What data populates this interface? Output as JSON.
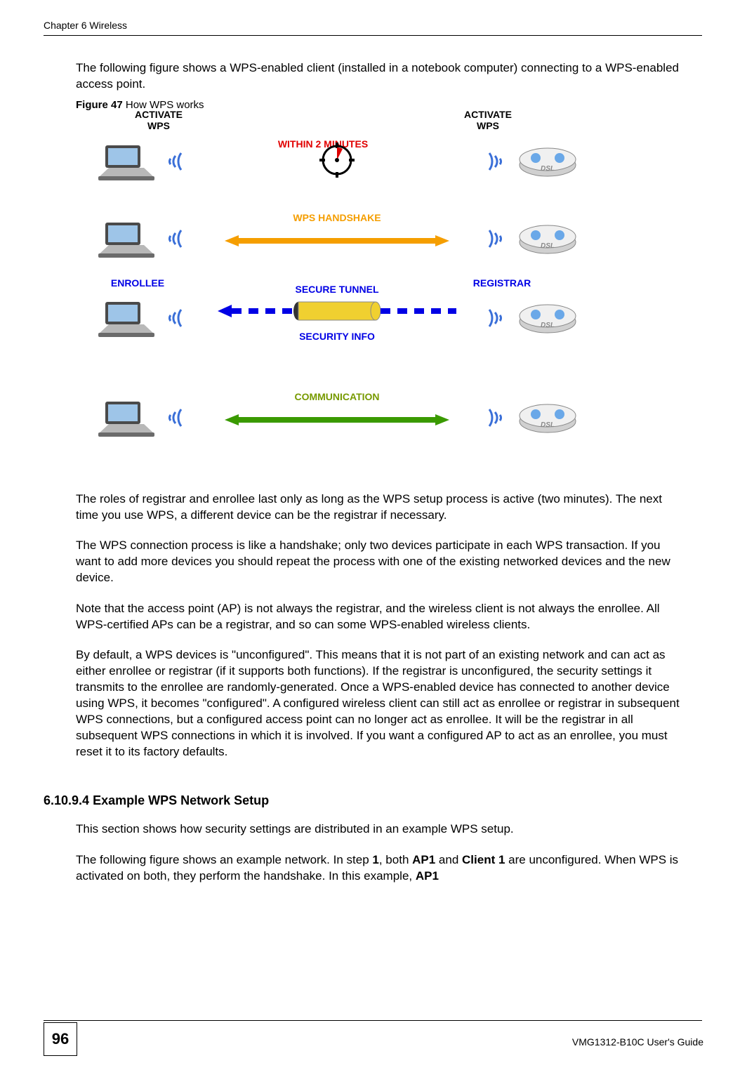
{
  "header": {
    "left": "Chapter 6 Wireless"
  },
  "paragraphs": {
    "p1": "The following figure shows a WPS-enabled client (installed in a notebook computer) connecting to a WPS-enabled access point.",
    "figcap_b": "Figure 47",
    "figcap_r": "   How WPS works",
    "p2": "The roles of registrar and enrollee last only as long as the WPS setup process is active (two minutes). The next time you use WPS, a different device can be the registrar if necessary.",
    "p3": "The WPS connection process is like a handshake; only two devices participate in each WPS transaction. If you want to add more devices you should repeat the process with one of the existing networked devices and the new device.",
    "p4": "Note that the access point (AP) is not always the registrar, and the wireless client is not always the enrollee. All WPS-certified APs can be a registrar, and so can some WPS-enabled wireless clients.",
    "p5": "By default, a WPS devices is \"unconfigured\". This means that it is not part of an existing network and can act as either enrollee or registrar (if it supports both functions). If the registrar is unconfigured, the security settings it transmits to the enrollee are randomly-generated. Once a WPS-enabled device has connected to another device using WPS, it becomes \"configured\". A configured wireless client can still act as enrollee or registrar in subsequent WPS connections, but a configured access point can no longer act as enrollee. It will be the registrar in all subsequent WPS connections in which it is involved. If you want a configured AP to act as an enrollee, you must reset it to its factory defaults.",
    "secnum": "6.10.9.4",
    "sectitle": "  Example WPS Network Setup",
    "p6": "This section shows how security settings are distributed in an example WPS setup.",
    "p7a": "The following figure shows an example network. In step ",
    "p7b": "1",
    "p7c": ", both ",
    "p7d": "AP1",
    "p7e": " and ",
    "p7f": "Client 1",
    "p7g": " are unconfigured. When WPS is activated on both, they perform the handshake. In this example, ",
    "p7h": "AP1"
  },
  "figure": {
    "activate_wps_l1": "ACTIVATE",
    "activate_wps_l2": "WPS",
    "within2min": "WITHIN 2 MINUTES",
    "wps_handshake": "WPS HANDSHAKE",
    "enrollee": "ENROLLEE",
    "registrar": "REGISTRAR",
    "secure_tunnel": "SECURE TUNNEL",
    "security_info": "SECURITY INFO",
    "communication": "COMMUNICATION",
    "dsl": "DSL"
  },
  "footer": {
    "page": "96",
    "guide": "VMG1312-B10C User's Guide"
  }
}
